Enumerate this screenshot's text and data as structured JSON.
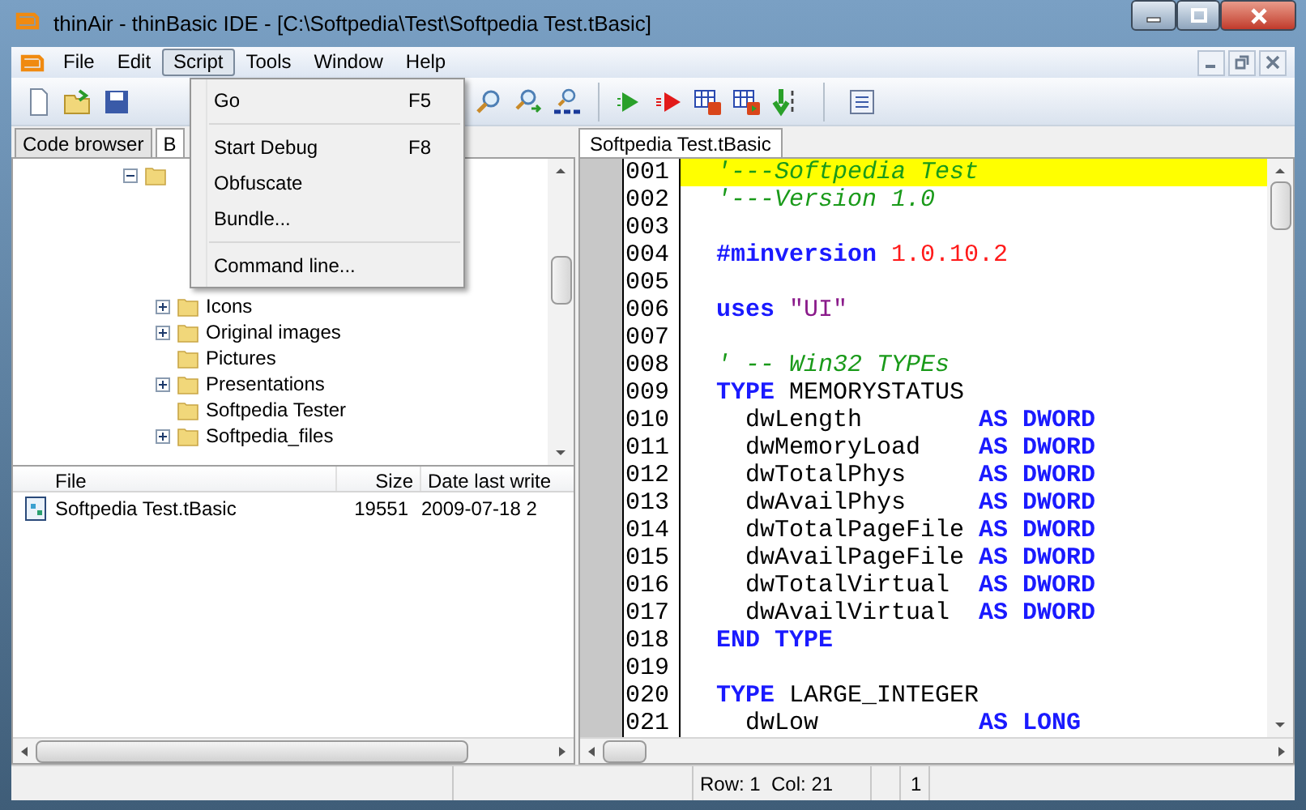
{
  "window": {
    "title": "thinAir - thinBasic IDE - [C:\\Softpedia\\Test\\Softpedia Test.tBasic]"
  },
  "menu_bar": [
    {
      "label": "File",
      "selected": false
    },
    {
      "label": "Edit",
      "selected": false
    },
    {
      "label": "Script",
      "selected": true
    },
    {
      "label": "Tools",
      "selected": false
    },
    {
      "label": "Window",
      "selected": false
    },
    {
      "label": "Help",
      "selected": false
    }
  ],
  "script_menu": [
    {
      "kind": "item",
      "label": "Go",
      "shortcut": "F5"
    },
    {
      "kind": "separator"
    },
    {
      "kind": "item",
      "label": "Start Debug",
      "shortcut": "F8"
    },
    {
      "kind": "item",
      "label": "Obfuscate"
    },
    {
      "kind": "item",
      "label": "Bundle..."
    },
    {
      "kind": "separator"
    },
    {
      "kind": "item",
      "label": "Command line..."
    }
  ],
  "left_tabs": [
    {
      "label": "Code browser",
      "selected": false
    },
    {
      "label": "B",
      "selected": true
    }
  ],
  "folder_tree": {
    "expanded": true,
    "children": [
      {
        "label": "Icons",
        "expandable": true
      },
      {
        "label": "Original images",
        "expandable": true
      },
      {
        "label": "Pictures",
        "expandable": false
      },
      {
        "label": "Presentations",
        "expandable": true
      },
      {
        "label": "Softpedia Tester",
        "expandable": false
      },
      {
        "label": "Softpedia_files",
        "expandable": true
      }
    ]
  },
  "file_list": {
    "columns": [
      "File",
      "Size",
      "Date last write"
    ],
    "rows": [
      {
        "file": "Softpedia Test.tBasic",
        "size": "19551",
        "date": "2009-07-18 2"
      }
    ]
  },
  "editor_tabs": [
    {
      "label": "Softpedia Test.tBasic",
      "selected": true
    }
  ],
  "code": [
    {
      "number": "001",
      "highlighted": true,
      "tokens": [
        {
          "kind": "comment",
          "text": "'---Softpedia Test"
        }
      ]
    },
    {
      "number": "002",
      "highlighted": false,
      "tokens": [
        {
          "kind": "comment",
          "text": "'---Version 1.0"
        }
      ]
    },
    {
      "number": "003",
      "highlighted": false
    },
    {
      "number": "004",
      "highlighted": false,
      "tokens": [
        {
          "kind": "keyword",
          "text": "#minversion"
        },
        {
          "kind": "number",
          "text": " 1.0.10.2"
        }
      ]
    },
    {
      "number": "005",
      "highlighted": false
    },
    {
      "number": "006",
      "highlighted": false,
      "tokens": [
        {
          "kind": "keyword",
          "text": "uses"
        },
        {
          "kind": "string",
          "text": " \"UI\""
        }
      ]
    },
    {
      "number": "007",
      "highlighted": false
    },
    {
      "number": "008",
      "highlighted": false,
      "tokens": [
        {
          "kind": "comment",
          "text": "' -- Win32 TYPEs"
        }
      ]
    },
    {
      "number": "009",
      "highlighted": false,
      "tokens": [
        {
          "kind": "keyword",
          "text": "TYPE"
        },
        {
          "kind": "text",
          "text": " MEMORYSTATUS"
        }
      ]
    },
    {
      "number": "010",
      "highlighted": false,
      "tokens": [
        {
          "kind": "text",
          "text": "  dwLength        "
        },
        {
          "kind": "keyword",
          "text": "AS DWORD"
        }
      ]
    },
    {
      "number": "011",
      "highlighted": false,
      "tokens": [
        {
          "kind": "text",
          "text": "  dwMemoryLoad    "
        },
        {
          "kind": "keyword",
          "text": "AS DWORD"
        }
      ]
    },
    {
      "number": "012",
      "highlighted": false,
      "tokens": [
        {
          "kind": "text",
          "text": "  dwTotalPhys     "
        },
        {
          "kind": "keyword",
          "text": "AS DWORD"
        }
      ]
    },
    {
      "number": "013",
      "highlighted": false,
      "tokens": [
        {
          "kind": "text",
          "text": "  dwAvailPhys     "
        },
        {
          "kind": "keyword",
          "text": "AS DWORD"
        }
      ]
    },
    {
      "number": "014",
      "highlighted": false,
      "tokens": [
        {
          "kind": "text",
          "text": "  dwTotalPageFile "
        },
        {
          "kind": "keyword",
          "text": "AS DWORD"
        }
      ]
    },
    {
      "number": "015",
      "highlighted": false,
      "tokens": [
        {
          "kind": "text",
          "text": "  dwAvailPageFile "
        },
        {
          "kind": "keyword",
          "text": "AS DWORD"
        }
      ]
    },
    {
      "number": "016",
      "highlighted": false,
      "tokens": [
        {
          "kind": "text",
          "text": "  dwTotalVirtual  "
        },
        {
          "kind": "keyword",
          "text": "AS DWORD"
        }
      ]
    },
    {
      "number": "017",
      "highlighted": false,
      "tokens": [
        {
          "kind": "text",
          "text": "  dwAvailVirtual  "
        },
        {
          "kind": "keyword",
          "text": "AS DWORD"
        }
      ]
    },
    {
      "number": "018",
      "highlighted": false,
      "tokens": [
        {
          "kind": "keyword",
          "text": "END TYPE"
        }
      ]
    },
    {
      "number": "019",
      "highlighted": false
    },
    {
      "number": "020",
      "highlighted": false,
      "tokens": [
        {
          "kind": "keyword",
          "text": "TYPE"
        },
        {
          "kind": "text",
          "text": " LARGE_INTEGER"
        }
      ]
    },
    {
      "number": "021",
      "highlighted": false,
      "tokens": [
        {
          "kind": "text",
          "text": "  dwLow           "
        },
        {
          "kind": "keyword",
          "text": "AS LONG"
        }
      ]
    }
  ],
  "status_bar": {
    "position": "Row: 1  Col: 21",
    "column_3": "1"
  }
}
